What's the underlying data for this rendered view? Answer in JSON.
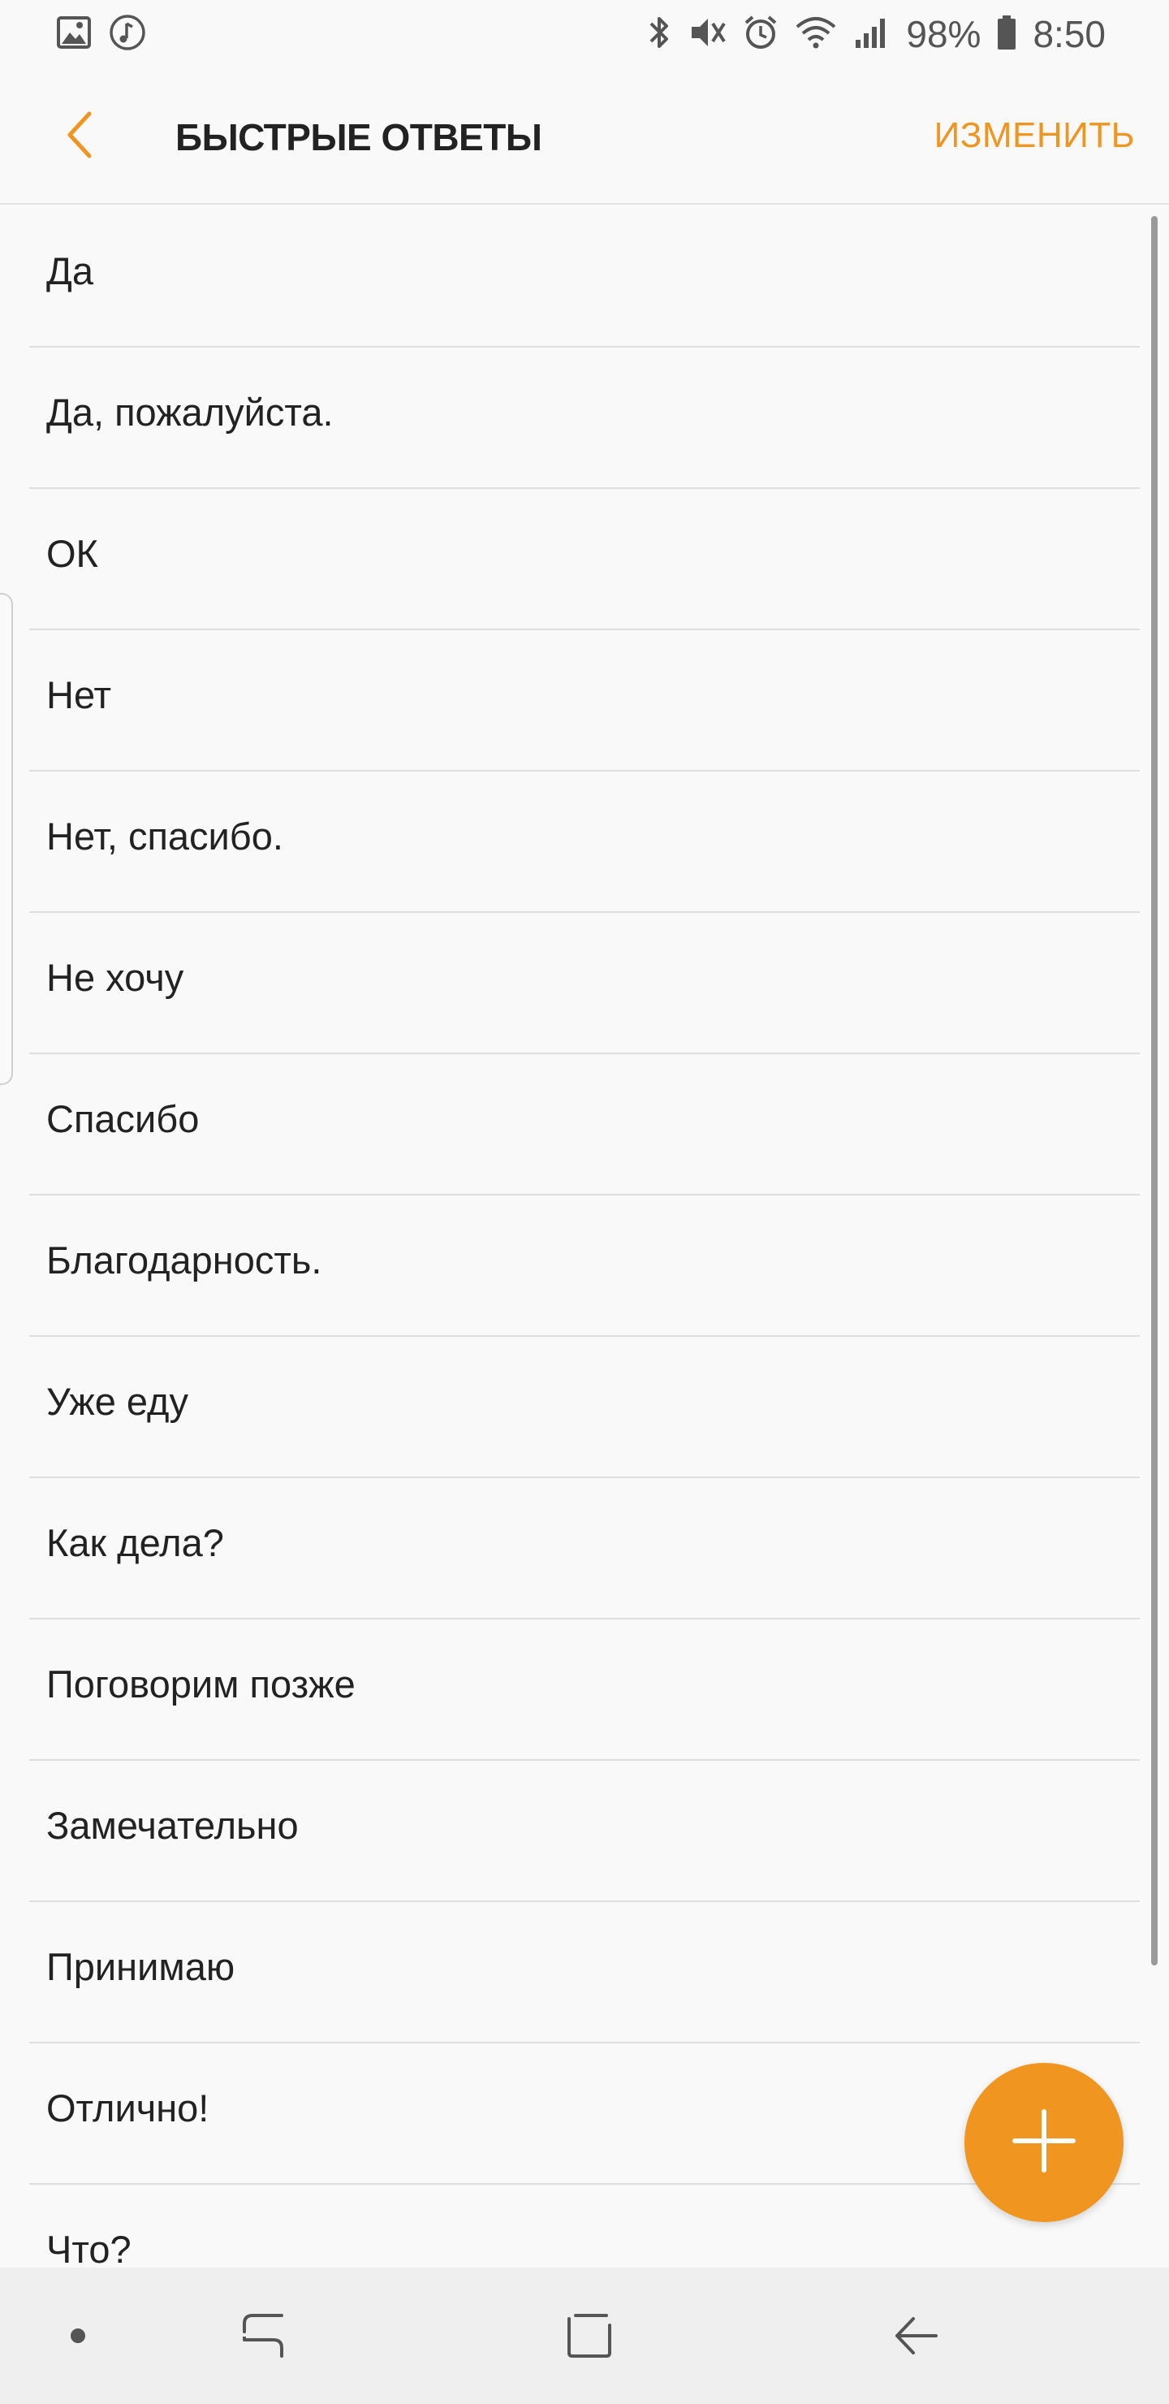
{
  "status_bar": {
    "battery": "98%",
    "time": "8:50",
    "icons": [
      "gallery-icon",
      "music-icon",
      "bluetooth-icon",
      "mute-vibrate-icon",
      "alarm-icon",
      "wifi-icon",
      "signal-icon",
      "battery-icon"
    ]
  },
  "header": {
    "title": "БЫСТРЫЕ ОТВЕТЫ",
    "edit_label": "ИЗМЕНИТЬ",
    "accent_color": "#f0951f"
  },
  "replies": [
    "Да",
    "Да, пожалуйста.",
    "ОК",
    "Нет",
    "Нет, спасибо.",
    "Не хочу",
    "Спасибо",
    "Благодарность.",
    "Уже еду",
    "Как дела?",
    "Поговорим позже",
    "Замечательно",
    "Принимаю",
    "Отлично!",
    "Что?"
  ],
  "fab": {
    "icon": "plus-icon",
    "color": "#f0951f"
  },
  "nav_bar": {
    "buttons": [
      "dot-button",
      "recent-apps-icon",
      "home-icon",
      "back-arrow-icon"
    ]
  }
}
